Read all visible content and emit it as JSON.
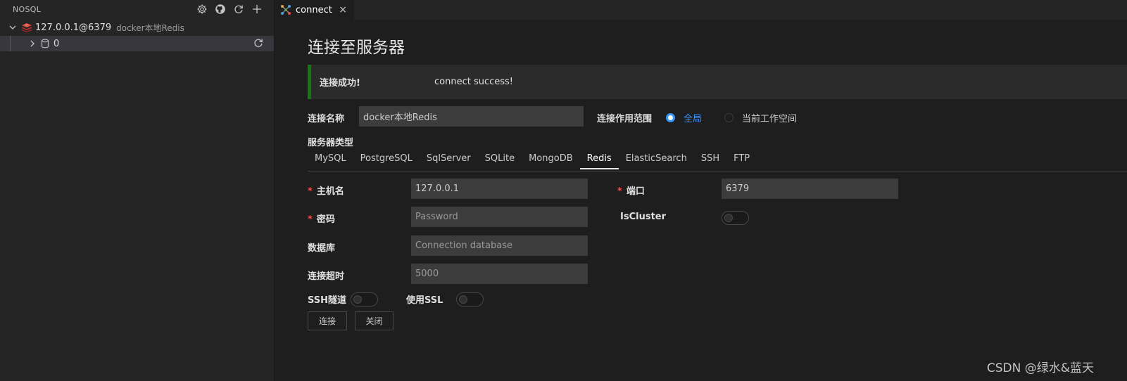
{
  "sidebar": {
    "title": "NOSQL",
    "host": {
      "label": "127.0.0.1@6379",
      "description": "docker本地Redis"
    },
    "db": {
      "label": "0"
    }
  },
  "tab": {
    "label": "connect",
    "close": "×"
  },
  "page": {
    "title": "连接至服务器"
  },
  "alert": {
    "title": "连接成功!",
    "message": "connect success!"
  },
  "form": {
    "conn_name_label": "连接名称",
    "conn_name_value": "docker本地Redis",
    "scope_label": "连接作用范围",
    "scope_options": [
      "全局",
      "当前工作空间"
    ],
    "scope_selected": "全局",
    "server_type_label": "服务器类型",
    "server_types": [
      "MySQL",
      "PostgreSQL",
      "SqlServer",
      "SQLite",
      "MongoDB",
      "Redis",
      "ElasticSearch",
      "SSH",
      "FTP"
    ],
    "server_type_selected": "Redis",
    "required_mark": "*",
    "host_label": "主机名",
    "host_value": "127.0.0.1",
    "port_label": "端口",
    "port_value": "6379",
    "password_label": "密码",
    "password_placeholder": "Password",
    "iscluster_label": "IsCluster",
    "iscluster_on": false,
    "database_label": "数据库",
    "database_placeholder": "Connection database",
    "timeout_label": "连接超时",
    "timeout_placeholder": "5000",
    "ssh_label": "SSH隧道",
    "ssh_on": false,
    "ssl_label": "使用SSL",
    "ssl_on": false,
    "connect_button": "连接",
    "close_button": "关闭"
  },
  "watermark": "CSDN @绿水&蓝天",
  "icons": [
    "gear-icon",
    "github-icon",
    "refresh-icon",
    "plus-icon",
    "chevron-down-icon",
    "chevron-right-icon",
    "redis-icon",
    "database-icon",
    "connect-tab-icon",
    "close-icon"
  ],
  "colors": {
    "accent": "#3794ff",
    "success": "#107c10",
    "required": "#f14c4c"
  }
}
